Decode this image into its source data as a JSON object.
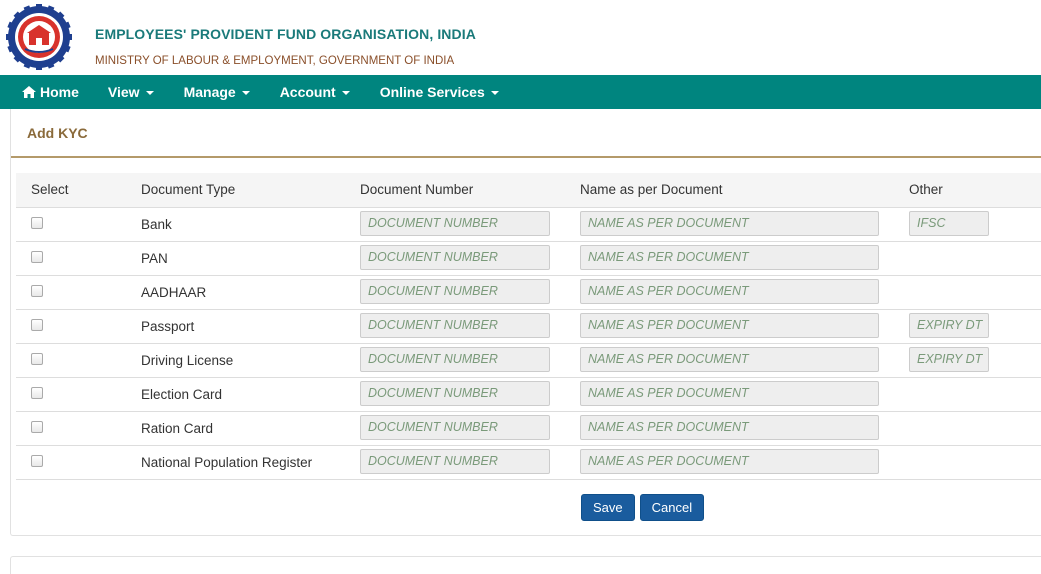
{
  "header": {
    "org_title": "EMPLOYEES' PROVIDENT FUND ORGANISATION, INDIA",
    "org_subtitle": "MINISTRY OF LABOUR & EMPLOYMENT, GOVERNMENT OF INDIA",
    "logo_icon": "epfo-emblem-icon"
  },
  "colors": {
    "navbar": "#00857f",
    "title_teal": "#1a7a7a",
    "subtitle_brown": "#8a4f2a",
    "panel_title": "#8a6a3a",
    "button_blue": "#1a5c9e"
  },
  "nav": {
    "items": [
      {
        "label": "Home",
        "icon": "home-icon",
        "dropdown": false
      },
      {
        "label": "View",
        "dropdown": true
      },
      {
        "label": "Manage",
        "dropdown": true
      },
      {
        "label": "Account",
        "dropdown": true
      },
      {
        "label": "Online Services",
        "dropdown": true
      }
    ]
  },
  "panel": {
    "title": "Add KYC"
  },
  "table": {
    "headers": {
      "select": "Select",
      "type": "Document Type",
      "number": "Document Number",
      "name": "Name as per Document",
      "other": "Other"
    },
    "rows": [
      {
        "type": "Bank",
        "number_placeholder": "DOCUMENT NUMBER",
        "name_placeholder": "NAME AS PER DOCUMENT",
        "other_placeholder": "IFSC"
      },
      {
        "type": "PAN",
        "number_placeholder": "DOCUMENT NUMBER",
        "name_placeholder": "NAME AS PER DOCUMENT",
        "other_placeholder": null
      },
      {
        "type": "AADHAAR",
        "number_placeholder": "DOCUMENT NUMBER",
        "name_placeholder": "NAME AS PER DOCUMENT",
        "other_placeholder": null
      },
      {
        "type": "Passport",
        "number_placeholder": "DOCUMENT NUMBER",
        "name_placeholder": "NAME AS PER DOCUMENT",
        "other_placeholder": "EXPIRY DT"
      },
      {
        "type": "Driving License",
        "number_placeholder": "DOCUMENT NUMBER",
        "name_placeholder": "NAME AS PER DOCUMENT",
        "other_placeholder": "EXPIRY DT"
      },
      {
        "type": "Election Card",
        "number_placeholder": "DOCUMENT NUMBER",
        "name_placeholder": "NAME AS PER DOCUMENT",
        "other_placeholder": null
      },
      {
        "type": "Ration Card",
        "number_placeholder": "DOCUMENT NUMBER",
        "name_placeholder": "NAME AS PER DOCUMENT",
        "other_placeholder": null
      },
      {
        "type": "National Population Register",
        "number_placeholder": "DOCUMENT NUMBER",
        "name_placeholder": "NAME AS PER DOCUMENT",
        "other_placeholder": null
      }
    ]
  },
  "actions": {
    "save_label": "Save",
    "cancel_label": "Cancel"
  }
}
